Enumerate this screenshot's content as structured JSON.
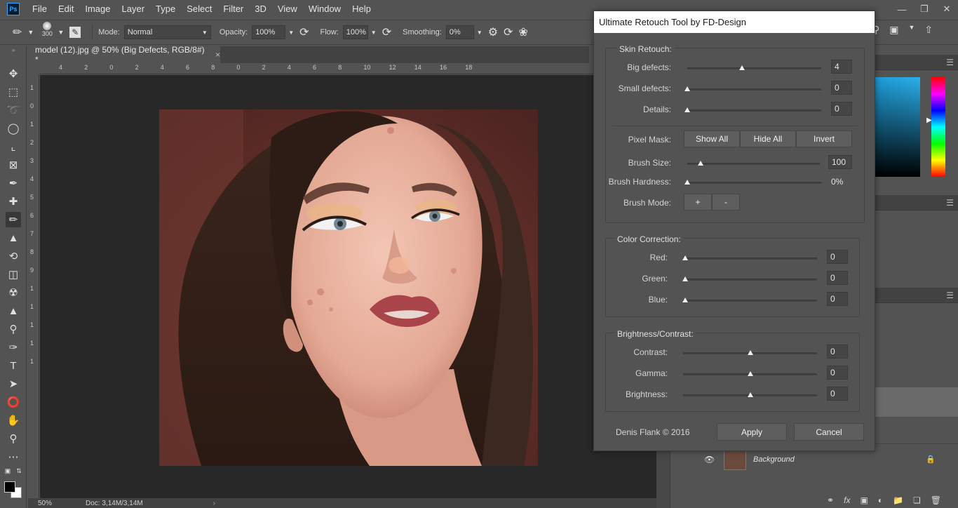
{
  "menubar": {
    "app_badge": "Ps",
    "items": [
      "File",
      "Edit",
      "Image",
      "Layer",
      "Type",
      "Select",
      "Filter",
      "3D",
      "View",
      "Window",
      "Help"
    ]
  },
  "options": {
    "brush_size": "300",
    "mode_label": "Mode:",
    "mode_value": "Normal",
    "opacity_label": "Opacity:",
    "opacity_value": "100%",
    "flow_label": "Flow:",
    "flow_value": "100%",
    "smoothing_label": "Smoothing:",
    "smoothing_value": "0%"
  },
  "document": {
    "tab_title": "model (12).jpg @ 50% (Big Defects, RGB/8#) *",
    "close_glyph": "×"
  },
  "rulers": {
    "h_ticks": [
      "4",
      "2",
      "0",
      "2",
      "4",
      "6",
      "8",
      "0",
      "2",
      "4",
      "6",
      "8",
      "10",
      "12",
      "14",
      "16",
      "18"
    ],
    "v_ticks": [
      "1",
      "0",
      "1",
      "2",
      "3",
      "4",
      "5",
      "6",
      "7",
      "8",
      "9",
      "1",
      "1",
      "1",
      "1",
      "1"
    ]
  },
  "status": {
    "zoom": "50%",
    "doc": "Doc: 3,14M/3,14M"
  },
  "layers": {
    "background_name": "Background"
  },
  "dialog": {
    "title": "Ultimate Retouch Tool by FD-Design",
    "skin": {
      "title": "Skin Retouch:",
      "big_defects_label": "Big defects:",
      "big_defects_value": "4",
      "big_defects_level": 0.41,
      "small_defects_label": "Small defects:",
      "small_defects_value": "0",
      "small_defects_level": 0,
      "details_label": "Details:",
      "details_value": "0",
      "details_level": 0,
      "pixel_mask_label": "Pixel Mask:",
      "show_all": "Show All",
      "hide_all": "Hide All",
      "invert": "Invert",
      "brush_size_label": "Brush Size:",
      "brush_size_value": "100",
      "brush_size_level": 0.1,
      "brush_hardness_label": "Brush Hardness:",
      "brush_hardness_value": "0%",
      "brush_hardness_level": 0,
      "brush_mode_label": "Brush Mode:",
      "plus": "+",
      "minus": "-"
    },
    "color": {
      "title": "Color Correction:",
      "red_label": "Red:",
      "red_value": "0",
      "green_label": "Green:",
      "green_value": "0",
      "blue_label": "Blue:",
      "blue_value": "0"
    },
    "brightness": {
      "title": "Brightness/Contrast:",
      "contrast_label": "Contrast:",
      "contrast_value": "0",
      "gamma_label": "Gamma:",
      "gamma_value": "0",
      "brightness_label": "Brightness:",
      "brightness_value": "0"
    },
    "footer": {
      "credit": "Denis Flank © 2016",
      "apply": "Apply",
      "cancel": "Cancel"
    }
  }
}
